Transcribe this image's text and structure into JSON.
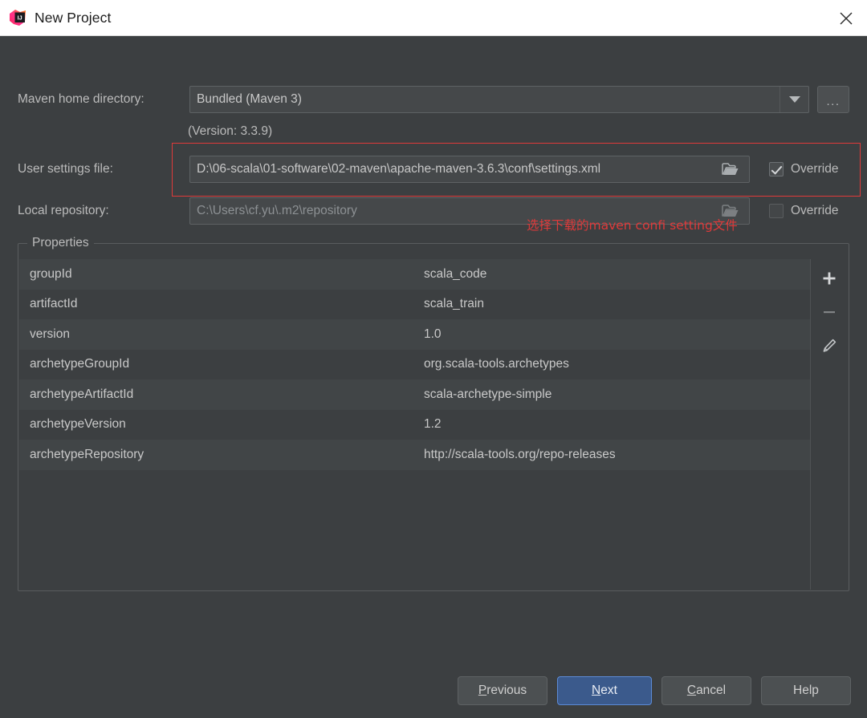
{
  "window": {
    "title": "New Project",
    "app_icon": "intellij-idea-icon",
    "close_icon": "close-icon"
  },
  "form": {
    "maven_home": {
      "label": "Maven home directory:",
      "value": "Bundled (Maven 3)",
      "dropdown_icon": "chevron-down-icon",
      "browse_label": "...",
      "version_note": "(Version: 3.3.9)"
    },
    "user_settings": {
      "label": "User settings file:",
      "value": "D:\\06-scala\\01-software\\02-maven\\apache-maven-3.6.3\\conf\\settings.xml",
      "browse_icon": "folder-open-icon",
      "override_label": "Override",
      "override_checked": true
    },
    "local_repository": {
      "label": "Local repository:",
      "value": "C:\\Users\\cf.yu\\.m2\\repository",
      "browse_icon": "folder-open-icon",
      "override_label": "Override",
      "override_checked": false
    }
  },
  "annotation": {
    "text": "选择下载的maven confi setting文件",
    "color": "#e03a3a"
  },
  "properties": {
    "legend": "Properties",
    "rows": [
      {
        "key": "groupId",
        "value": "scala_code"
      },
      {
        "key": "artifactId",
        "value": "scala_train"
      },
      {
        "key": "version",
        "value": "1.0"
      },
      {
        "key": "archetypeGroupId",
        "value": "org.scala-tools.archetypes"
      },
      {
        "key": "archetypeArtifactId",
        "value": "scala-archetype-simple"
      },
      {
        "key": "archetypeVersion",
        "value": "1.2"
      },
      {
        "key": "archetypeRepository",
        "value": "http://scala-tools.org/repo-releases"
      }
    ],
    "toolbar": [
      {
        "name": "add-property-button",
        "icon": "plus-icon",
        "enabled": true
      },
      {
        "name": "remove-property-button",
        "icon": "minus-icon",
        "enabled": false
      },
      {
        "name": "edit-property-button",
        "icon": "pencil-icon",
        "enabled": true
      }
    ]
  },
  "buttons": {
    "previous": "Previous",
    "next": "Next",
    "cancel": "Cancel",
    "help": "Help"
  },
  "colors": {
    "dialog_bg": "#3c3f41",
    "titlebar_bg": "#ffffff",
    "accent_blue": "#3b5a8c",
    "annotation_red": "#e03a3a"
  }
}
